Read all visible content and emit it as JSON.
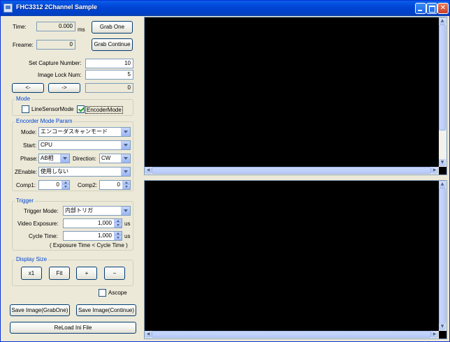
{
  "window": {
    "title": "FHC3312 2Channel Sample"
  },
  "capture": {
    "time_label": "Time:",
    "time_value": "0.000",
    "time_unit": "ms",
    "frame_label": "Freame:",
    "frame_value": "0",
    "grab_one": "Grab One",
    "grab_continue": "Grab Continue",
    "set_capture_label": "Set Capture Number:",
    "set_capture_value": "10",
    "image_lock_label": "Image Lock Num:",
    "image_lock_value": "5",
    "prev_button": "<-",
    "next_button": "->",
    "index_value": "0"
  },
  "mode": {
    "title": "Mode",
    "line_sensor_label": "LineSensorMode",
    "line_sensor_checked": false,
    "encoder_label": "EncoderMode",
    "encoder_checked": true
  },
  "encoder": {
    "title": "Encorder Mode Param",
    "mode_label": "Mode:",
    "mode_value": "エンコーダスキャンモード",
    "start_label": "Start:",
    "start_value": "CPU",
    "phase_label": "Phase:",
    "phase_value": "AB相",
    "direction_label": "Direction:",
    "direction_value": "CW",
    "zenable_label": "ZEnable:",
    "zenable_value": "使用しない",
    "comp1_label": "Comp1:",
    "comp1_value": "0",
    "comp2_label": "Comp2:",
    "comp2_value": "0"
  },
  "trigger": {
    "title": "Trigger",
    "mode_label": "Trigger Mode:",
    "mode_value": "内部トリガ",
    "exposure_label": "Video Exposure:",
    "exposure_value": "1,000",
    "exposure_unit": "us",
    "cycle_label": "Cycle Time:",
    "cycle_value": "1,000",
    "cycle_unit": "us",
    "note": "( Exposure Time < Cycle Time )"
  },
  "display": {
    "title": "Display Size",
    "x1": "x1",
    "fit": "Fit",
    "plus": "+",
    "minus": "−"
  },
  "ascope": {
    "label": "Ascope",
    "checked": false
  },
  "bottom": {
    "save_grab_one": "Save Image(GrabOne)",
    "save_continue": "Save Image(Continue)",
    "reload": "ReLoad Ini File"
  }
}
